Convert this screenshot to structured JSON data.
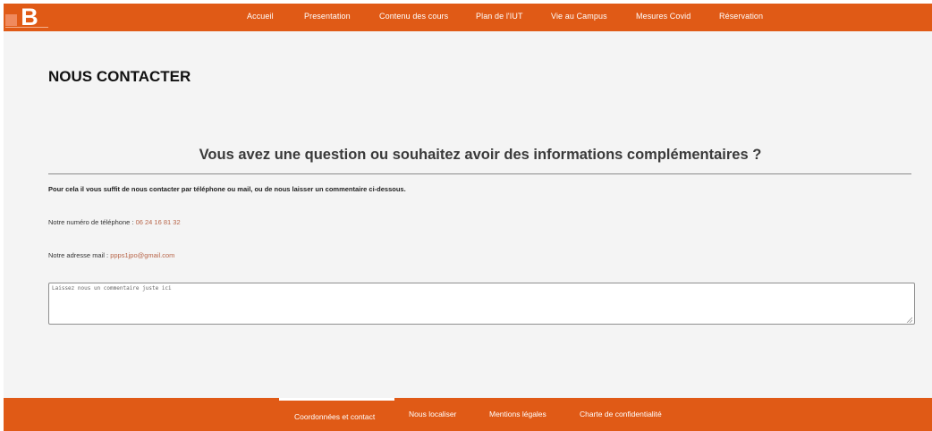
{
  "brand": {
    "logo_text": "uB",
    "accent_color": "#e05a16"
  },
  "nav": {
    "items": [
      {
        "label": "Accueil"
      },
      {
        "label": "Presentation"
      },
      {
        "label": "Contenu des cours"
      },
      {
        "label": "Plan de l'IUT"
      },
      {
        "label": "Vie au Campus"
      },
      {
        "label": "Mesures Covid"
      },
      {
        "label": "Réservation"
      }
    ]
  },
  "main": {
    "title": "NOUS CONTACTER",
    "question": "Vous avez une question ou souhaitez avoir des informations complémentaires ?",
    "intro": "Pour cela il vous suffit de nous contacter par téléphone ou mail, ou de nous laisser un commentaire ci-dessous.",
    "phone_label": "Notre numéro de téléphone : ",
    "phone_value": "06 24 16 81 32",
    "mail_label": "Notre adresse mail : ",
    "mail_value": "ppps1jpo@gmail.com",
    "comment": {
      "placeholder": "Laissez nous un commentaire juste ici",
      "value": ""
    }
  },
  "footer": {
    "items": [
      {
        "label": "Coordonnées et contact",
        "active": true
      },
      {
        "label": "Nous localiser"
      },
      {
        "label": "Mentions légales"
      },
      {
        "label": "Charte de confidentialité"
      }
    ]
  }
}
